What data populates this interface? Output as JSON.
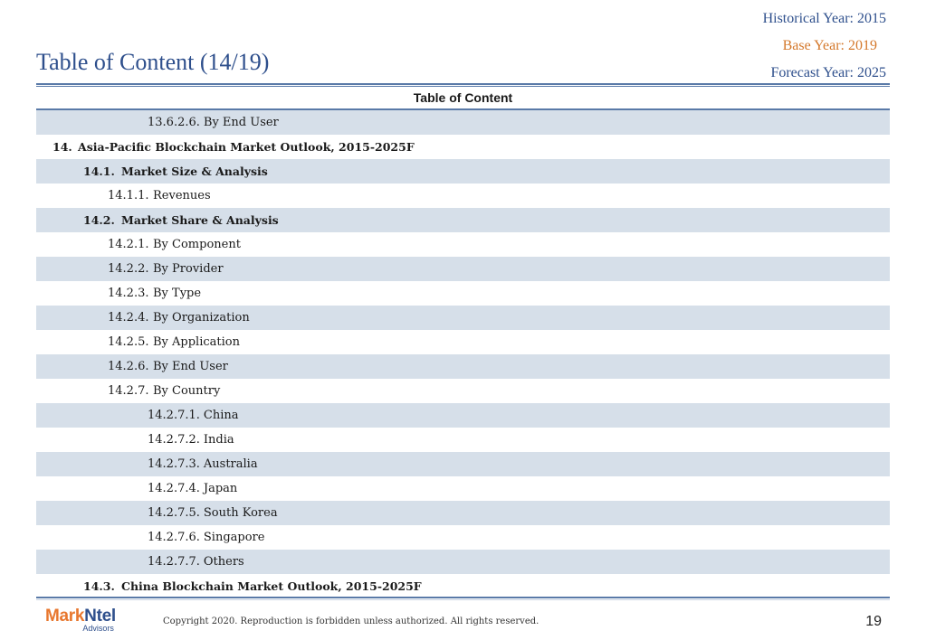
{
  "header": {
    "title": "Table of Content (14/19)",
    "historical_year": "Historical Year: 2015",
    "base_year": "Base Year: 2019",
    "forecast_year": "Forecast Year: 2025"
  },
  "toc": {
    "heading": "Table of Content",
    "rows": [
      {
        "num": "13.6.2.6.",
        "label": "By End User",
        "level": 3,
        "bold": false
      },
      {
        "num": "14.",
        "label": "Asia-Pacific Blockchain Market Outlook, 2015-2025F",
        "level": 0,
        "bold": true
      },
      {
        "num": "14.1.",
        "label": "Market Size & Analysis",
        "level": 1,
        "bold": true
      },
      {
        "num": "14.1.1.",
        "label": "Revenues",
        "level": 2,
        "bold": false
      },
      {
        "num": "14.2.",
        "label": "Market Share & Analysis",
        "level": 1,
        "bold": true
      },
      {
        "num": "14.2.1.",
        "label": "By Component",
        "level": 2,
        "bold": false
      },
      {
        "num": "14.2.2.",
        "label": "By Provider",
        "level": 2,
        "bold": false
      },
      {
        "num": "14.2.3.",
        "label": "By Type",
        "level": 2,
        "bold": false
      },
      {
        "num": "14.2.4.",
        "label": "By Organization",
        "level": 2,
        "bold": false
      },
      {
        "num": "14.2.5.",
        "label": "By Application",
        "level": 2,
        "bold": false
      },
      {
        "num": "14.2.6.",
        "label": "By End User",
        "level": 2,
        "bold": false
      },
      {
        "num": "14.2.7.",
        "label": "By Country",
        "level": 2,
        "bold": false
      },
      {
        "num": "14.2.7.1.",
        "label": "China",
        "level": 3,
        "bold": false
      },
      {
        "num": "14.2.7.2.",
        "label": "India",
        "level": 3,
        "bold": false
      },
      {
        "num": "14.2.7.3.",
        "label": "Australia",
        "level": 3,
        "bold": false
      },
      {
        "num": "14.2.7.4.",
        "label": "Japan",
        "level": 3,
        "bold": false
      },
      {
        "num": "14.2.7.5.",
        "label": "South Korea",
        "level": 3,
        "bold": false
      },
      {
        "num": "14.2.7.6.",
        "label": "Singapore",
        "level": 3,
        "bold": false
      },
      {
        "num": "14.2.7.7.",
        "label": "Others",
        "level": 3,
        "bold": false
      },
      {
        "num": "14.3.",
        "label": "China Blockchain Market Outlook, 2015-2025F",
        "level": 1,
        "bold": true
      }
    ]
  },
  "footer": {
    "logo_mark": "Mark",
    "logo_ntel": "Ntel",
    "logo_sub": "Advisors",
    "copyright": "Copyright 2020. Reproduction is forbidden unless authorized. All rights reserved.",
    "page_number": "19"
  },
  "colors": {
    "accent_blue": "#2e4f8c",
    "accent_orange": "#d4782b",
    "row_shade": "#d6dfe9"
  }
}
